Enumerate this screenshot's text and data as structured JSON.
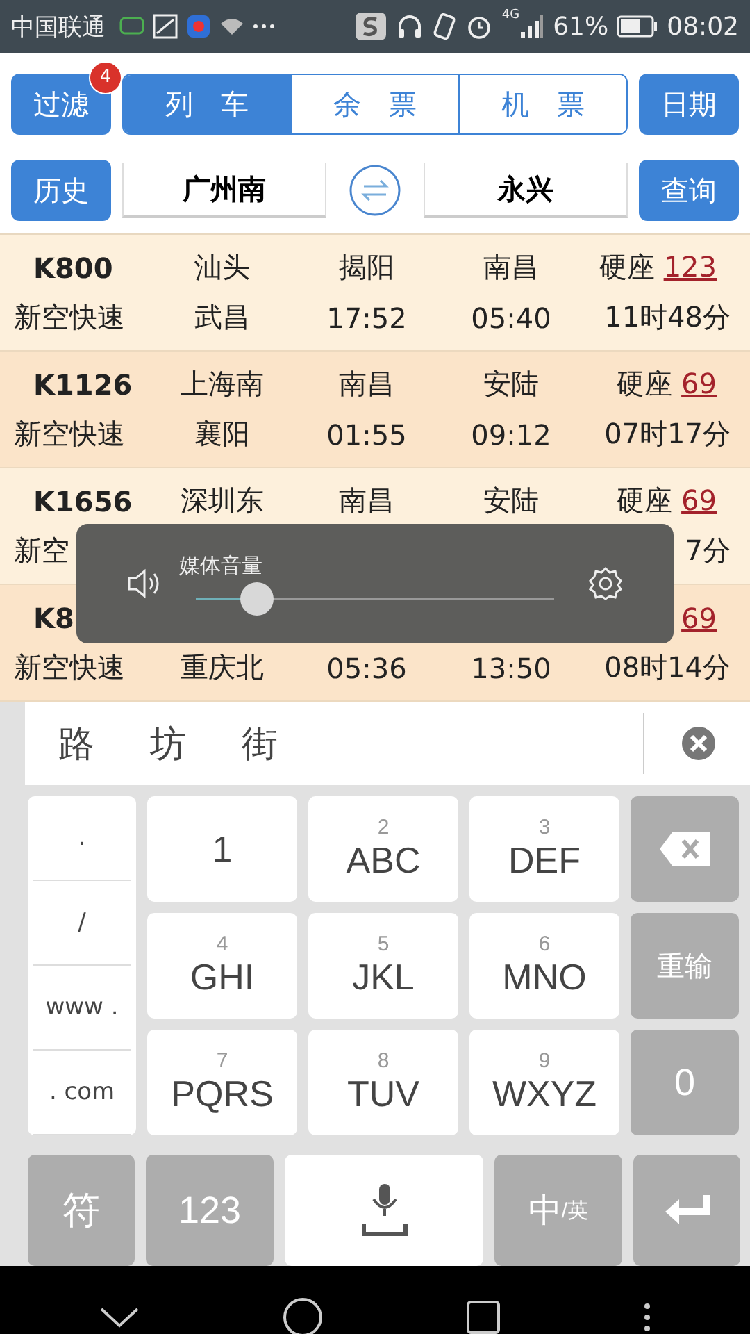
{
  "status_bar": {
    "carrier": "中国联通",
    "network": "4G",
    "battery": "61%",
    "time": "08:02"
  },
  "top_bar": {
    "filter_button": {
      "label": "过滤",
      "badge": "4"
    },
    "tabs": [
      {
        "label": "列 车",
        "selected": true
      },
      {
        "label": "余 票",
        "selected": false
      },
      {
        "label": "机 票",
        "selected": false
      }
    ],
    "date_button": "日期"
  },
  "route_bar": {
    "history_button": "历史",
    "from_station": "广州南",
    "to_station": "永兴",
    "query_button": "查询"
  },
  "trains": [
    {
      "train_no": "K800",
      "train_type": "新空快速",
      "origin": "汕头",
      "terminus": "武昌",
      "board_station": "揭阳",
      "depart_time": "17:52",
      "alight_station": "南昌",
      "arrive_time": "05:40",
      "seat_type": "硬座",
      "seat_count": "123",
      "duration": "11时48分"
    },
    {
      "train_no": "K1126",
      "train_type": "新空快速",
      "origin": "上海南",
      "terminus": "襄阳",
      "board_station": "南昌",
      "depart_time": "01:55",
      "alight_station": "安陆",
      "arrive_time": "09:12",
      "seat_type": "硬座",
      "seat_count": "69",
      "duration": "07时17分"
    },
    {
      "train_no": "K1656",
      "train_type": "新空",
      "origin": "深圳东",
      "board_station": "南昌",
      "alight_station": "安陆",
      "seat_type": "硬座",
      "seat_count": "69",
      "duration": "7分"
    },
    {
      "train_no": "K8",
      "train_type": "新空快速",
      "terminus": "重庆北",
      "depart_time": "05:36",
      "arrive_time": "13:50",
      "seat_count": "69",
      "duration": "08时14分"
    }
  ],
  "volume_popup": {
    "title": "媒体音量",
    "level": 0.17
  },
  "keyboard": {
    "candidates": [
      "路",
      "坊",
      "街"
    ],
    "side_keys": [
      ".",
      "/",
      "www .",
      ". com"
    ],
    "one_key": "1",
    "keys": [
      {
        "digit": "2",
        "letters": "ABC"
      },
      {
        "digit": "3",
        "letters": "DEF"
      },
      {
        "digit": "4",
        "letters": "GHI"
      },
      {
        "digit": "5",
        "letters": "JKL"
      },
      {
        "digit": "6",
        "letters": "MNO"
      },
      {
        "digit": "7",
        "letters": "PQRS"
      },
      {
        "digit": "8",
        "letters": "TUV"
      },
      {
        "digit": "9",
        "letters": "WXYZ"
      }
    ],
    "retype_key": "重输",
    "zero_key": "0",
    "symbol_key": "符",
    "number_key": "123",
    "lang_key": {
      "main": "中",
      "sub": "/英"
    }
  }
}
